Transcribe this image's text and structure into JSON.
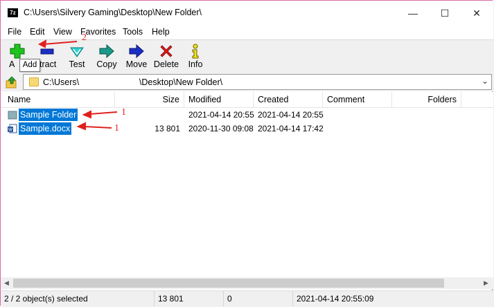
{
  "window": {
    "title": "C:\\Users\\Silvery Gaming\\Desktop\\New Folder\\",
    "app_icon_text": "7z"
  },
  "window_controls": {
    "minimize": "—",
    "maximize": "☐",
    "close": "✕"
  },
  "menu": [
    "File",
    "Edit",
    "View",
    "Favorites",
    "Tools",
    "Help"
  ],
  "toolbar": [
    {
      "label": "Add",
      "icon": "plus-icon"
    },
    {
      "label": "Extract",
      "icon": "minus-icon"
    },
    {
      "label": "Test",
      "icon": "check-icon"
    },
    {
      "label": "Copy",
      "icon": "copy-arrow-icon"
    },
    {
      "label": "Move",
      "icon": "move-arrow-icon"
    },
    {
      "label": "Delete",
      "icon": "delete-x-icon"
    },
    {
      "label": "Info",
      "icon": "info-icon"
    }
  ],
  "toolbar_visible_labels": {
    "add": "A",
    "extract": "tract"
  },
  "tooltip": "Add",
  "address": {
    "path": "C:\\Users\\                         \\Desktop\\New Folder\\"
  },
  "columns": [
    "Name",
    "Size",
    "Modified",
    "Created",
    "Comment",
    "Folders"
  ],
  "rows": [
    {
      "name": "Sample Folder",
      "size": "",
      "modified": "2021-04-14 20:55",
      "created": "2021-04-14 20:55",
      "type": "folder"
    },
    {
      "name": "Sample.docx",
      "size": "13 801",
      "modified": "2020-11-30 09:08",
      "created": "2021-04-14 17:42",
      "type": "docx"
    }
  ],
  "status": {
    "selected": "2 / 2 object(s) selected",
    "size": "13 801",
    "packed": "0",
    "datetime": "2021-04-14 20:55:09"
  },
  "annotations": {
    "one_a": "1",
    "one_b": "1",
    "two": "2"
  },
  "colors": {
    "accent_selection": "#0078d7",
    "annotation_red": "#e0201c",
    "window_border": "#d96ba8"
  }
}
